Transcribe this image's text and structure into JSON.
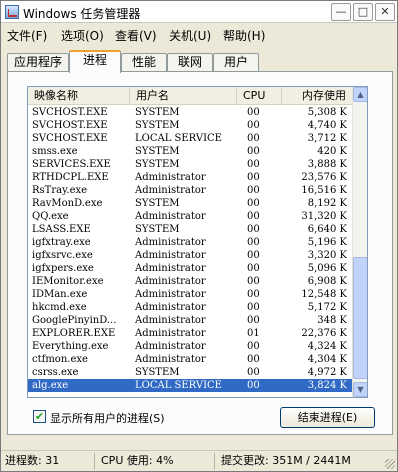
{
  "window": {
    "title": "Windows 任务管理器",
    "controls": {
      "minimize": "—",
      "maximize": "□",
      "close": "✕"
    }
  },
  "menu": [
    "文件(F)",
    "选项(O)",
    "查看(V)",
    "关机(U)",
    "帮助(H)"
  ],
  "tabs": [
    "应用程序",
    "进程",
    "性能",
    "联网",
    "用户"
  ],
  "active_tab": "进程",
  "columns": {
    "name": "映像名称",
    "user": "用户名",
    "cpu": "CPU",
    "mem": "内存使用"
  },
  "processes": [
    {
      "name": "SVCHOST.EXE",
      "user": "SYSTEM",
      "cpu": "00",
      "mem": "5,308 K"
    },
    {
      "name": "SVCHOST.EXE",
      "user": "SYSTEM",
      "cpu": "00",
      "mem": "4,740 K"
    },
    {
      "name": "SVCHOST.EXE",
      "user": "LOCAL SERVICE",
      "cpu": "00",
      "mem": "3,712 K"
    },
    {
      "name": "smss.exe",
      "user": "SYSTEM",
      "cpu": "00",
      "mem": "420 K"
    },
    {
      "name": "SERVICES.EXE",
      "user": "SYSTEM",
      "cpu": "00",
      "mem": "3,888 K"
    },
    {
      "name": "RTHDCPL.EXE",
      "user": "Administrator",
      "cpu": "00",
      "mem": "23,576 K"
    },
    {
      "name": "RsTray.exe",
      "user": "Administrator",
      "cpu": "00",
      "mem": "16,516 K"
    },
    {
      "name": "RavMonD.exe",
      "user": "SYSTEM",
      "cpu": "00",
      "mem": "8,192 K"
    },
    {
      "name": "QQ.exe",
      "user": "Administrator",
      "cpu": "00",
      "mem": "31,320 K"
    },
    {
      "name": "LSASS.EXE",
      "user": "SYSTEM",
      "cpu": "00",
      "mem": "6,640 K"
    },
    {
      "name": "igfxtray.exe",
      "user": "Administrator",
      "cpu": "00",
      "mem": "5,196 K"
    },
    {
      "name": "igfxsrvc.exe",
      "user": "Administrator",
      "cpu": "00",
      "mem": "3,320 K"
    },
    {
      "name": "igfxpers.exe",
      "user": "Administrator",
      "cpu": "00",
      "mem": "5,096 K"
    },
    {
      "name": "IEMonitor.exe",
      "user": "Administrator",
      "cpu": "00",
      "mem": "6,908 K"
    },
    {
      "name": "IDMan.exe",
      "user": "Administrator",
      "cpu": "00",
      "mem": "12,548 K"
    },
    {
      "name": "hkcmd.exe",
      "user": "Administrator",
      "cpu": "00",
      "mem": "5,172 K"
    },
    {
      "name": "GooglePinyinD...",
      "user": "Administrator",
      "cpu": "00",
      "mem": "348 K"
    },
    {
      "name": "EXPLORER.EXE",
      "user": "Administrator",
      "cpu": "01",
      "mem": "22,376 K"
    },
    {
      "name": "Everything.exe",
      "user": "Administrator",
      "cpu": "00",
      "mem": "4,324 K"
    },
    {
      "name": "ctfmon.exe",
      "user": "Administrator",
      "cpu": "00",
      "mem": "4,304 K"
    },
    {
      "name": "csrss.exe",
      "user": "SYSTEM",
      "cpu": "00",
      "mem": "4,972 K"
    },
    {
      "name": "alg.exe",
      "user": "LOCAL SERVICE",
      "cpu": "00",
      "mem": "3,824 K"
    }
  ],
  "selected_process": "alg.exe",
  "show_all_users": {
    "label": "显示所有用户的进程(S)",
    "checked": true
  },
  "end_process_label": "结束进程(E)",
  "status": {
    "processes": "进程数: 31",
    "cpu": "CPU 使用: 4%",
    "commit": "提交更改: 351M / 2441M"
  }
}
